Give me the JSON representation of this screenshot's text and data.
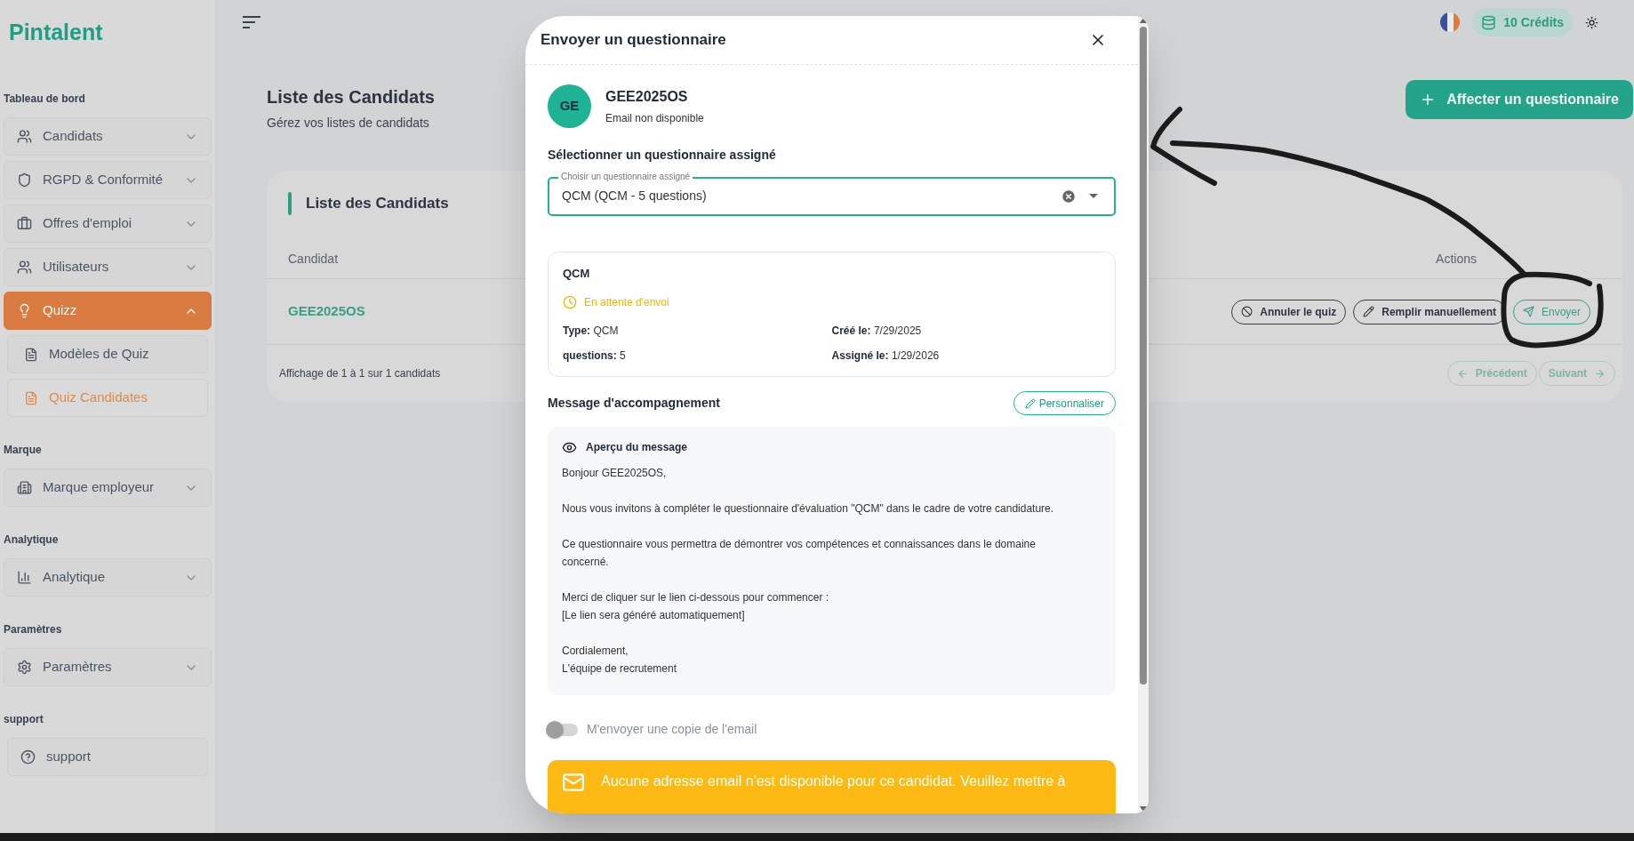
{
  "logo": "Pintalent",
  "sidebar": [
    {
      "title": "Tableau de bord",
      "items": [
        {
          "label": "Candidats",
          "selected": false,
          "expanded": false
        },
        {
          "label": "RGPD & Conformité",
          "selected": false,
          "expanded": false
        },
        {
          "label": "Offres d'emploi",
          "selected": false,
          "expanded": false
        },
        {
          "label": "Utilisateurs",
          "selected": false,
          "expanded": false
        },
        {
          "label": "Quizz",
          "selected": true,
          "expanded": true,
          "children": [
            {
              "label": "Modèles de Quiz",
              "selected": false
            },
            {
              "label": "Quiz Candidates",
              "selected": true
            }
          ]
        }
      ]
    },
    {
      "title": "Marque",
      "items": [
        {
          "label": "Marque employeur",
          "selected": false,
          "expanded": false
        }
      ]
    },
    {
      "title": "Analytique",
      "items": [
        {
          "label": "Analytique",
          "selected": false,
          "expanded": false
        }
      ]
    },
    {
      "title": "Paramètres",
      "items": [
        {
          "label": "Paramètres",
          "selected": false,
          "expanded": false
        }
      ]
    },
    {
      "title": "support",
      "items": [
        {
          "label": "support",
          "selected": false
        }
      ]
    }
  ],
  "topbar": {
    "credits": "10 Crédits"
  },
  "page": {
    "title": "Liste des Candidats",
    "subtitle": "Gérez vos listes de candidats",
    "primary_button": "Affecter un questionnaire"
  },
  "table": {
    "title": "Liste des Candidats",
    "columns": [
      "Candidat",
      "Actions"
    ],
    "rows": [
      {
        "candidate": "GEE2025OS",
        "actions": [
          {
            "kind": "cancel",
            "label": "Annuler le quiz"
          },
          {
            "kind": "edit",
            "label": "Remplir manuellement"
          },
          {
            "kind": "send",
            "label": "Envoyer"
          }
        ]
      }
    ],
    "summary": "Affichage de 1 à 1 sur 1 candidats",
    "pagination": [
      {
        "kind": "prev",
        "label": "Précédent",
        "disabled": true
      },
      {
        "kind": "next",
        "label": "Suivant",
        "disabled": true
      }
    ]
  },
  "dialog": {
    "title": "Envoyer un questionnaire",
    "avatar": "GE",
    "name": "GEE2025OS",
    "email": "Email non disponible",
    "select_heading": "Sélectionner un questionnaire assigné",
    "select_label": "Choisir un questionnaire assigné",
    "select_value": "QCM (QCM - 5 questions)",
    "quiz": {
      "title": "QCM",
      "status": "En attente d'envoi",
      "fields": [
        {
          "label": "Type:",
          "value": "QCM"
        },
        {
          "label": "Créé le:",
          "value": "7/29/2025"
        },
        {
          "label": "questions:",
          "value": "5"
        },
        {
          "label": "Assigné le:",
          "value": "1/29/2026"
        }
      ]
    },
    "message_heading": "Message d'accompagnement",
    "customize_button": "Personnaliser",
    "preview_title": "Aperçu du message",
    "message_paragraphs": [
      [
        "Bonjour GEE2025OS,"
      ],
      [
        "Nous vous invitons à compléter le questionnaire d'évaluation \"QCM\" dans le cadre de votre candidature."
      ],
      [
        "Ce questionnaire vous permettra de démontrer vos compétences et connaissances dans le domaine concerné."
      ],
      [
        "Merci de cliquer sur le lien ci-dessous pour commencer :",
        "[Le lien sera généré automatiquement]"
      ],
      [
        "Cordialement,",
        "L'équipe de recrutement"
      ]
    ],
    "copy_toggle": {
      "label": "M'envoyer une copie de l'email",
      "on": false
    },
    "warning": "Aucune adresse email n'est disponible pour ce candidat. Veuillez mettre à"
  }
}
